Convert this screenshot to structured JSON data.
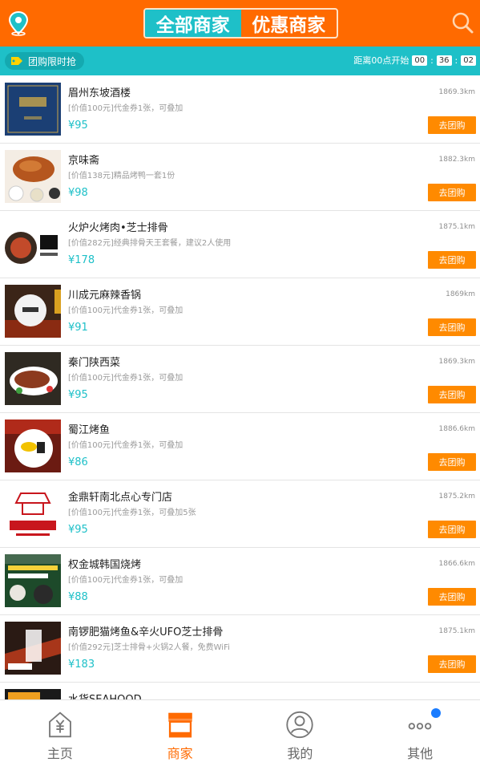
{
  "header": {
    "location_icon": "location-pin-icon",
    "search_icon": "search-icon",
    "tabs": [
      {
        "label": "全部商家",
        "active": true
      },
      {
        "label": "优惠商家",
        "active": false
      }
    ]
  },
  "promo": {
    "label": "团购限时抢",
    "icon": "tag-icon",
    "countdown_label": "距离00点开始",
    "hours": "00",
    "minutes": "36",
    "seconds": "02"
  },
  "merchants": [
    {
      "name": "眉州东坡酒楼",
      "desc": "[价值100元]代金券1张，可叠加",
      "price": "¥95",
      "distance": "1869.3km",
      "button": "去团购"
    },
    {
      "name": "京味斋",
      "desc": "[价值138元]精品烤鸭一套1份",
      "price": "¥98",
      "distance": "1882.3km",
      "button": "去团购"
    },
    {
      "name": "火炉火烤肉•芝士排骨",
      "desc": "[价值282元]经典排骨天王套餐，建议2人使用",
      "price": "¥178",
      "distance": "1875.1km",
      "button": "去团购"
    },
    {
      "name": "川成元麻辣香锅",
      "desc": "[价值100元]代金券1张，可叠加",
      "price": "¥91",
      "distance": "1869km",
      "button": "去团购"
    },
    {
      "name": "秦门陕西菜",
      "desc": "[价值100元]代金券1张，可叠加",
      "price": "¥95",
      "distance": "1869.3km",
      "button": "去团购"
    },
    {
      "name": "蜀江烤鱼",
      "desc": "[价值100元]代金券1张，可叠加",
      "price": "¥86",
      "distance": "1886.6km",
      "button": "去团购"
    },
    {
      "name": "金鼎轩南北点心专门店",
      "desc": "[价值100元]代金券1张，可叠加5张",
      "price": "¥95",
      "distance": "1875.2km",
      "button": "去团购"
    },
    {
      "name": "权金城韩国烧烤",
      "desc": "[价值100元]代金券1张，可叠加",
      "price": "¥88",
      "distance": "1866.6km",
      "button": "去团购"
    },
    {
      "name": "南锣肥猫烤鱼&辛火UFO芝士排骨",
      "desc": "[价值292元]芝士排骨+火锅2人餐，免费WiFi",
      "price": "¥183",
      "distance": "1875.1km",
      "button": "去团购"
    },
    {
      "name": "水货SEAHOOD",
      "desc": "",
      "price": "",
      "distance": "",
      "button": ""
    }
  ],
  "nav": [
    {
      "label": "主页",
      "icon": "home-yuan-icon",
      "active": false
    },
    {
      "label": "商家",
      "icon": "shop-icon",
      "active": true
    },
    {
      "label": "我的",
      "icon": "user-icon",
      "active": false
    },
    {
      "label": "其他",
      "icon": "more-dots-icon",
      "active": false
    }
  ],
  "colors": {
    "header": "#ff6a00",
    "teal": "#1ec0c8",
    "button": "#ff8a00",
    "badge": "#1a7cff"
  }
}
